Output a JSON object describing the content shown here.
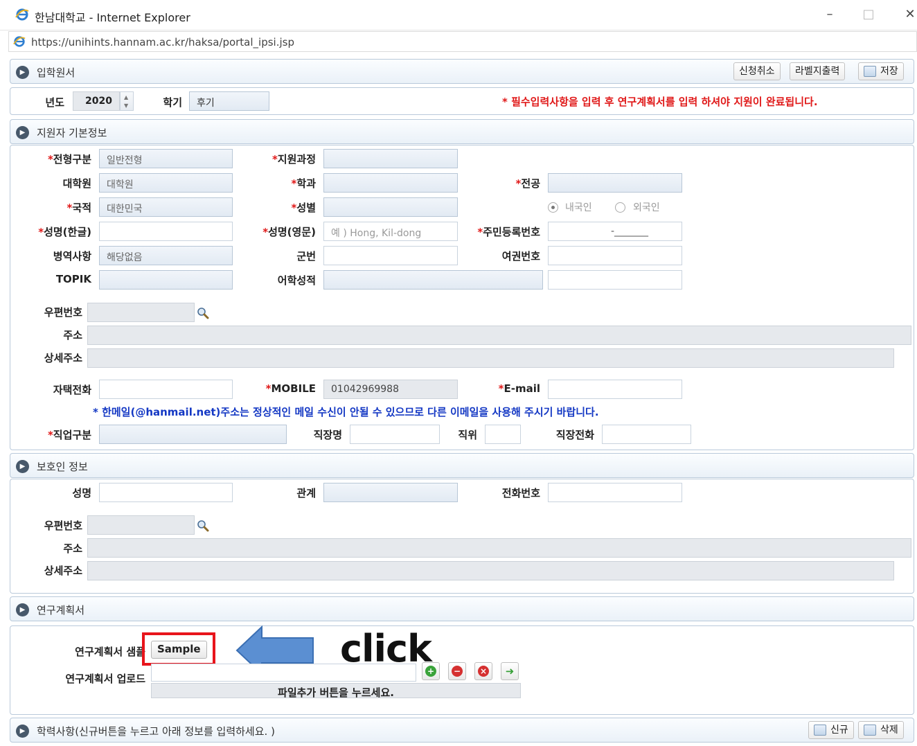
{
  "window": {
    "title": "한남대학교 - Internet Explorer",
    "url": "https://unihints.hannam.ac.kr/haksa/portal_ipsi.jsp",
    "min": "–",
    "max": "□",
    "close": "✕"
  },
  "header": {
    "title": "입학원서",
    "buttons": {
      "cancel": "신청취소",
      "label_print": "라벨지출력",
      "save": "저장"
    }
  },
  "term": {
    "year_label": "년도",
    "year_value": "2020",
    "semester_label": "학기",
    "semester_value": "후기",
    "notice": "* 필수입력사항을 입력 후 연구계획서를 입력 하셔야 지원이 완료됩니다."
  },
  "applicant": {
    "section_title": "지원자 기본정보",
    "admission_type": {
      "label": "전형구분",
      "value": "일반전형"
    },
    "program": {
      "label": "지원과정",
      "value": ""
    },
    "graduate_school": {
      "label": "대학원",
      "value": "대학원"
    },
    "department": {
      "label": "학과",
      "value": ""
    },
    "major": {
      "label": "전공",
      "value": ""
    },
    "nationality": {
      "label": "국적",
      "value": "대한민국"
    },
    "gender": {
      "label": "성별",
      "value": ""
    },
    "domestic": "내국인",
    "foreign": "외국인",
    "name_kr": {
      "label": "성명(한글)",
      "value": ""
    },
    "name_en": {
      "label": "성명(영문)",
      "placeholder": "예 ) Hong, Kil-dong"
    },
    "rrn": {
      "label": "주민등록번호",
      "value": "-_______"
    },
    "military": {
      "label": "병역사항",
      "value": "해당없음"
    },
    "military_no": {
      "label": "군번",
      "value": ""
    },
    "passport": {
      "label": "여권번호",
      "value": ""
    },
    "topik": {
      "label": "TOPIK",
      "value": ""
    },
    "language_score": {
      "label": "어학성적",
      "value": ""
    },
    "postcode": {
      "label": "우편번호"
    },
    "address": {
      "label": "주소"
    },
    "address_detail": {
      "label": "상세주소"
    },
    "home_phone": {
      "label": "자택전화",
      "value": ""
    },
    "mobile": {
      "label": "MOBILE",
      "value": "01042969988"
    },
    "email": {
      "label": "E-mail",
      "value": ""
    },
    "email_notice": "* 한메일(@hanmail.net)주소는  정상적인 메일 수신이 안될 수 있으므로 다른 이메일을 사용해 주시기 바랍니다.",
    "job_type": {
      "label": "직업구분"
    },
    "workplace": {
      "label": "직장명"
    },
    "position": {
      "label": "직위"
    },
    "work_phone": {
      "label": "직장전화"
    }
  },
  "guardian": {
    "section_title": "보호인 정보",
    "name": {
      "label": "성명"
    },
    "relation": {
      "label": "관계"
    },
    "phone": {
      "label": "전화번호"
    },
    "postcode": {
      "label": "우편번호"
    },
    "address": {
      "label": "주소"
    },
    "address_detail": {
      "label": "상세주소"
    }
  },
  "research": {
    "section_title": "연구계획서",
    "sample_label": "연구계획서 샘플",
    "sample_button": "Sample",
    "upload_label": "연구계획서 업로드",
    "upload_hint": "파일추가 버튼을 누르세요.",
    "annotation": "click"
  },
  "education": {
    "section_title": "학력사항(신규버튼을 누르고 아래 정보를 입력하세요. )",
    "buttons": {
      "new": "신규",
      "delete": "삭제"
    }
  },
  "colors": {
    "required": "#e01818",
    "notice_blue": "#1438c4",
    "annotation_box": "#e8141b",
    "arrow": "#5b8fd2"
  }
}
